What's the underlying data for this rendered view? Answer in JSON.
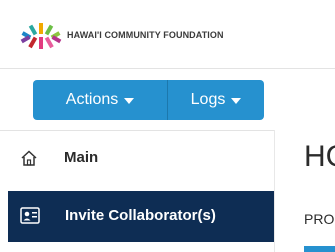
{
  "header": {
    "org_name": "HAWAI'I COMMUNITY FOUNDATION",
    "logo_icon": "hcf-logo-icon"
  },
  "toolbar": {
    "actions_label": "Actions",
    "logs_label": "Logs"
  },
  "sidebar": {
    "items": [
      {
        "label": "Main",
        "icon": "home-icon",
        "active": false
      },
      {
        "label": "Invite Collaborator(s)",
        "icon": "contact-card-icon",
        "active": true
      }
    ]
  },
  "main": {
    "heading": "HC",
    "tab_label": "PRO"
  },
  "colors": {
    "accent": "#2691cf",
    "active_nav": "#0e2d54"
  }
}
